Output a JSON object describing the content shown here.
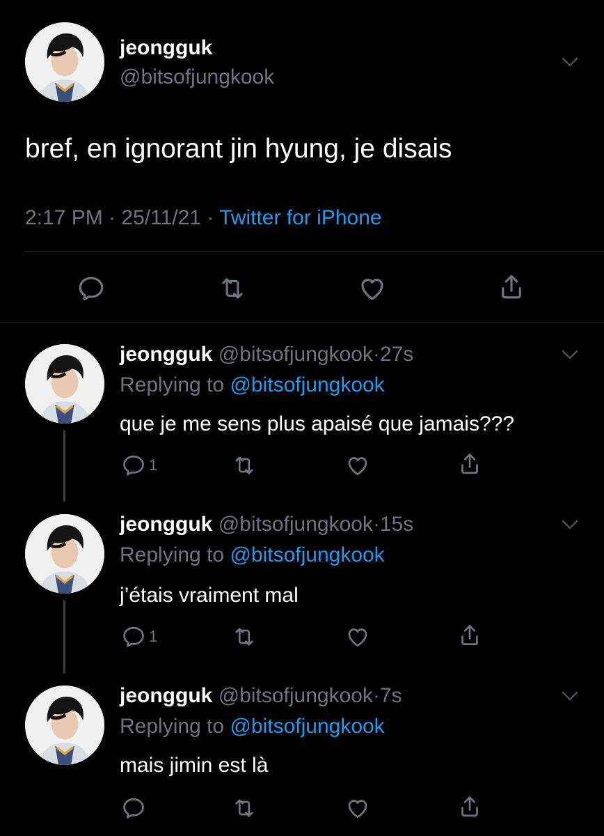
{
  "main_tweet": {
    "display_name": "jeongguk",
    "handle": "@bitsofjungkook",
    "text": "bref, en ignorant jin hyung, je disais",
    "time": "2:17 PM",
    "separator": "·",
    "date": "25/11/21",
    "source": "Twitter for iPhone"
  },
  "replies": [
    {
      "display_name": "jeongguk",
      "handle": "@bitsofjungkook",
      "dot": "·",
      "time": "27s",
      "replying_prefix": "Replying to",
      "replying_to": "@bitsofjungkook",
      "text": "que je me sens plus apaisé que jamais???",
      "reply_count": "1"
    },
    {
      "display_name": "jeongguk",
      "handle": "@bitsofjungkook",
      "dot": "·",
      "time": "15s",
      "replying_prefix": "Replying to",
      "replying_to": "@bitsofjungkook",
      "text": "j’étais vraiment mal",
      "reply_count": "1"
    },
    {
      "display_name": "jeongguk",
      "handle": "@bitsofjungkook",
      "dot": "·",
      "time": "7s",
      "replying_prefix": "Replying to",
      "replying_to": "@bitsofjungkook",
      "text": "mais jimin est là",
      "reply_count": ""
    }
  ],
  "colors": {
    "background": "#000000",
    "text": "#ffffff",
    "secondary": "#6e767d",
    "accent": "#1d9bf0",
    "divider": "#2f3336"
  },
  "icons": [
    "reply-icon",
    "retweet-icon",
    "like-icon",
    "share-icon",
    "chevron-down-icon"
  ]
}
